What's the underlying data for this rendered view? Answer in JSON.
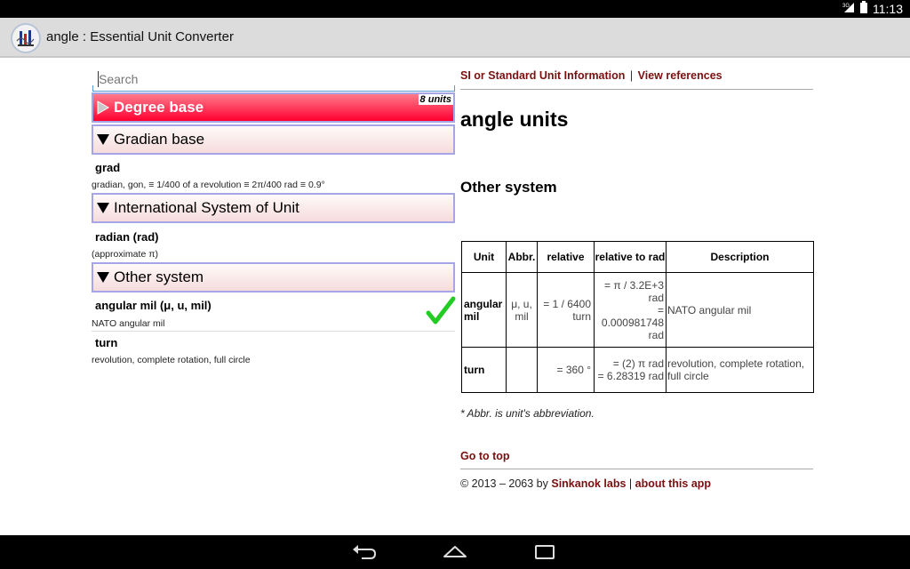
{
  "status_bar": {
    "network": "3G",
    "time": "11:13"
  },
  "action_bar": {
    "title": "angle : Essential Unit Converter",
    "app_icon": "unit-converter-app-icon"
  },
  "search": {
    "placeholder": "Search"
  },
  "groups": [
    {
      "label": "Degree base",
      "badge": "8 units",
      "expanded": false,
      "active": true
    },
    {
      "label": "Gradian base",
      "expanded": true,
      "units": [
        {
          "name": "grad",
          "desc": "gradian, gon,  ≡  1/400 of a revolution  ≡  2π/400 rad  ≡  0.9°"
        }
      ]
    },
    {
      "label": "International System of Unit",
      "expanded": true,
      "units": [
        {
          "name": "radian (rad)",
          "desc": "(approximate π)"
        }
      ]
    },
    {
      "label": "Other system",
      "expanded": true,
      "units": [
        {
          "name": "angular mil (μ, u, mil)",
          "desc": "NATO angular mil",
          "selected": true
        },
        {
          "name": "turn",
          "desc": "revolution, complete rotation, full circle"
        }
      ]
    }
  ],
  "right": {
    "links": {
      "si_info": "SI or Standard Unit Information",
      "sep": "|",
      "view_refs": "View references"
    },
    "heading": "angle units",
    "subheading": "Other system",
    "table": {
      "headers": [
        "Unit",
        "Abbr.",
        "relative",
        "relative to rad",
        "Description"
      ],
      "rows": [
        {
          "unit": "angular mil",
          "abbr": "μ, u, mil",
          "relative": "= 1 / 6400 turn",
          "relative_rad_1": "= π / 3.2E+3 rad",
          "relative_rad_2": "= 0.000981748 rad",
          "description": "NATO angular mil"
        },
        {
          "unit": "turn",
          "abbr": "",
          "relative": "= 360 °",
          "relative_rad_1": "= (2) π rad",
          "relative_rad_2": "= 6.28319 rad",
          "description": "revolution, complete rotation, full circle"
        }
      ]
    },
    "footnote": "* Abbr. is unit's abbreviation.",
    "go_to_top": "Go to top",
    "copyright_prefix": "© 2013 – 2063 by",
    "copyright_company": "Sinkanok labs",
    "copyright_sep": "|",
    "copyright_about": "about this app"
  },
  "colors": {
    "active_header": "#ff0030",
    "link": "#7a1010",
    "header_border": "#a6a6e6",
    "check": "#22cc22"
  },
  "nav": {
    "back_icon": "back-icon",
    "home_icon": "home-icon",
    "recents_icon": "recents-icon"
  }
}
